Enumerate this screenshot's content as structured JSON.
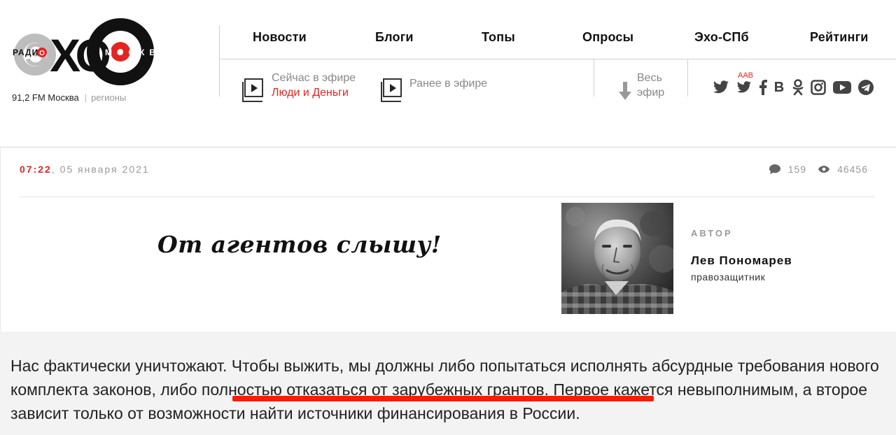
{
  "header": {
    "logo": {
      "text_left": "РАДИО",
      "text_center": "ЭХО",
      "text_right": "МОСКВЫ",
      "accent_color": "#e52421"
    },
    "frequency": "91,2 FM Москва",
    "regions": "регионы",
    "nav": [
      "Новости",
      "Блоги",
      "Топы",
      "Опросы",
      "Эхо-СПб",
      "Рейтинги"
    ],
    "on_air": {
      "label": "Сейчас в эфире",
      "program": "Люди и Деньги",
      "icon": "play-icon"
    },
    "earlier": {
      "label": "Ранее в эфире",
      "icon": "play-icon"
    },
    "all_air": {
      "line1": "Весь",
      "line2": "эфир",
      "icon": "download-arrow-icon"
    },
    "aab": "AAB",
    "social": [
      "twitter-icon",
      "twitter-aab-icon",
      "facebook-icon",
      "vk-icon",
      "odnoklassniki-icon",
      "instagram-icon",
      "youtube-icon",
      "telegram-icon"
    ]
  },
  "article": {
    "time": "07:22",
    "date": ", 05 января 2021",
    "comments": "159",
    "views": "46456",
    "title": "От агентов слышу!",
    "author_label": "АВТОР",
    "author_name": "Лев Пономарев",
    "author_role": "правозащитник"
  },
  "quote": {
    "part1": "Нас фактически уничтожают. Чтобы выжить, мы должны либо попытаться исполнять абсурдные требования нового комплекта законов, ",
    "highlight": "либо полностью отказаться от зарубежных грантов.",
    "part2": " Первое кажется невыполнимым, а второе зависит только от возможности найти источники финансирования в России.",
    "highlight_color": "#ff1a00"
  }
}
